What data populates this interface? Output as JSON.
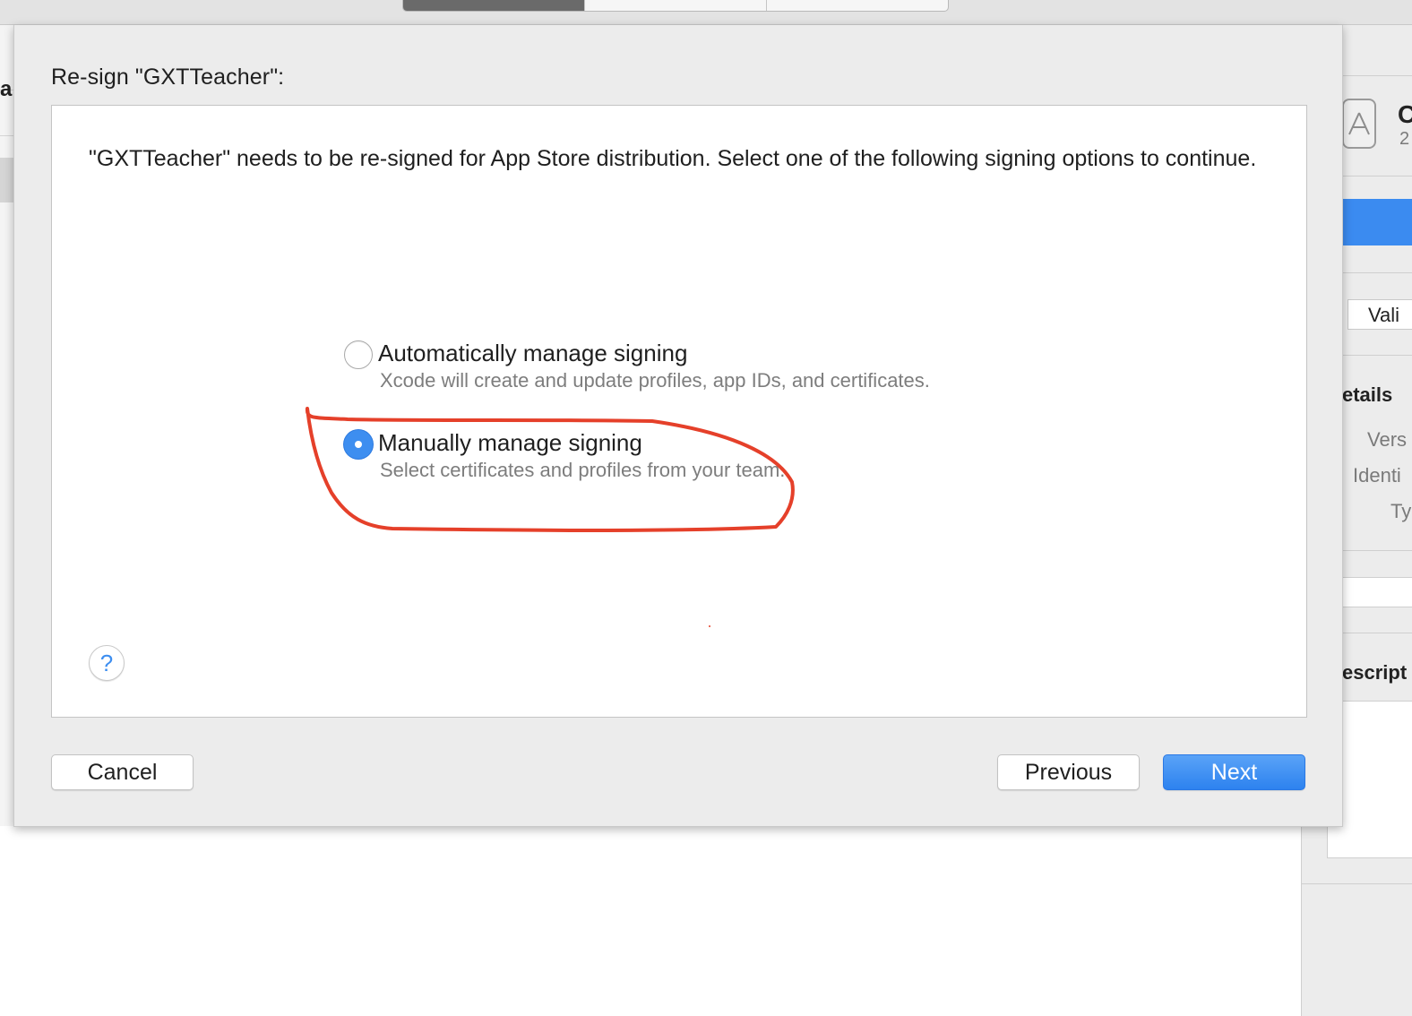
{
  "background": {
    "left_label": "ar",
    "right_panel": {
      "validate_label": "Vali",
      "details_heading": "etails",
      "version_label": "Vers",
      "identifier_label": "Identi",
      "type_label": "Ty",
      "description_heading": "escript",
      "top_letters": "C",
      "top_digit": "2"
    }
  },
  "sheet": {
    "title": "Re-sign \"GXTTeacher\":",
    "description": "\"GXTTeacher\" needs to be re-signed for App Store distribution. Select one of the following signing options to continue.",
    "options": [
      {
        "label": "Automatically manage signing",
        "subtitle": "Xcode will create and update profiles, app IDs, and certificates.",
        "selected": false
      },
      {
        "label": "Manually manage signing",
        "subtitle": "Select certificates and profiles from your team.",
        "selected": true
      }
    ],
    "help_symbol": "?",
    "buttons": {
      "cancel": "Cancel",
      "previous": "Previous",
      "next": "Next"
    },
    "annotation_color": "#e5402a"
  },
  "colors": {
    "accent": "#3d8ef0",
    "sheet_bg": "#ececec"
  }
}
